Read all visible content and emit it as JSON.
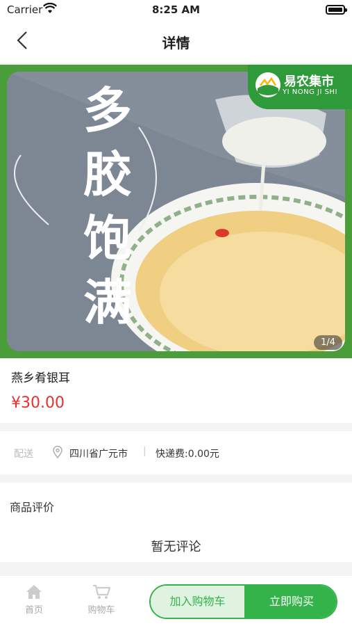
{
  "status": {
    "carrier": "Carrier",
    "time": "8:25 AM"
  },
  "nav": {
    "title": "详情"
  },
  "gallery": {
    "slogan": [
      "多",
      "胶",
      "饱",
      "满"
    ],
    "brand_name": "易农集市",
    "brand_pinyin": "YI NONG JI SHI",
    "counter": "1/4"
  },
  "product": {
    "name": "燕乡肴银耳",
    "price": "¥30.00"
  },
  "shipping": {
    "label": "配送",
    "location": "四川省广元市",
    "fee": "快递费:0.00元",
    "separator": "|"
  },
  "reviews": {
    "title": "商品评价",
    "empty_text": "暂无评论"
  },
  "bottom": {
    "home_label": "首页",
    "cart_label": "购物车",
    "add_to_cart": "加入购物车",
    "buy_now": "立即购买"
  },
  "colors": {
    "accent": "#34b34a",
    "price": "#e9302b",
    "banner_green": "#4a9e3a"
  },
  "icons": [
    "wifi-icon",
    "battery-icon",
    "back-arrow-icon",
    "location-pin-icon",
    "home-icon",
    "cart-icon"
  ]
}
